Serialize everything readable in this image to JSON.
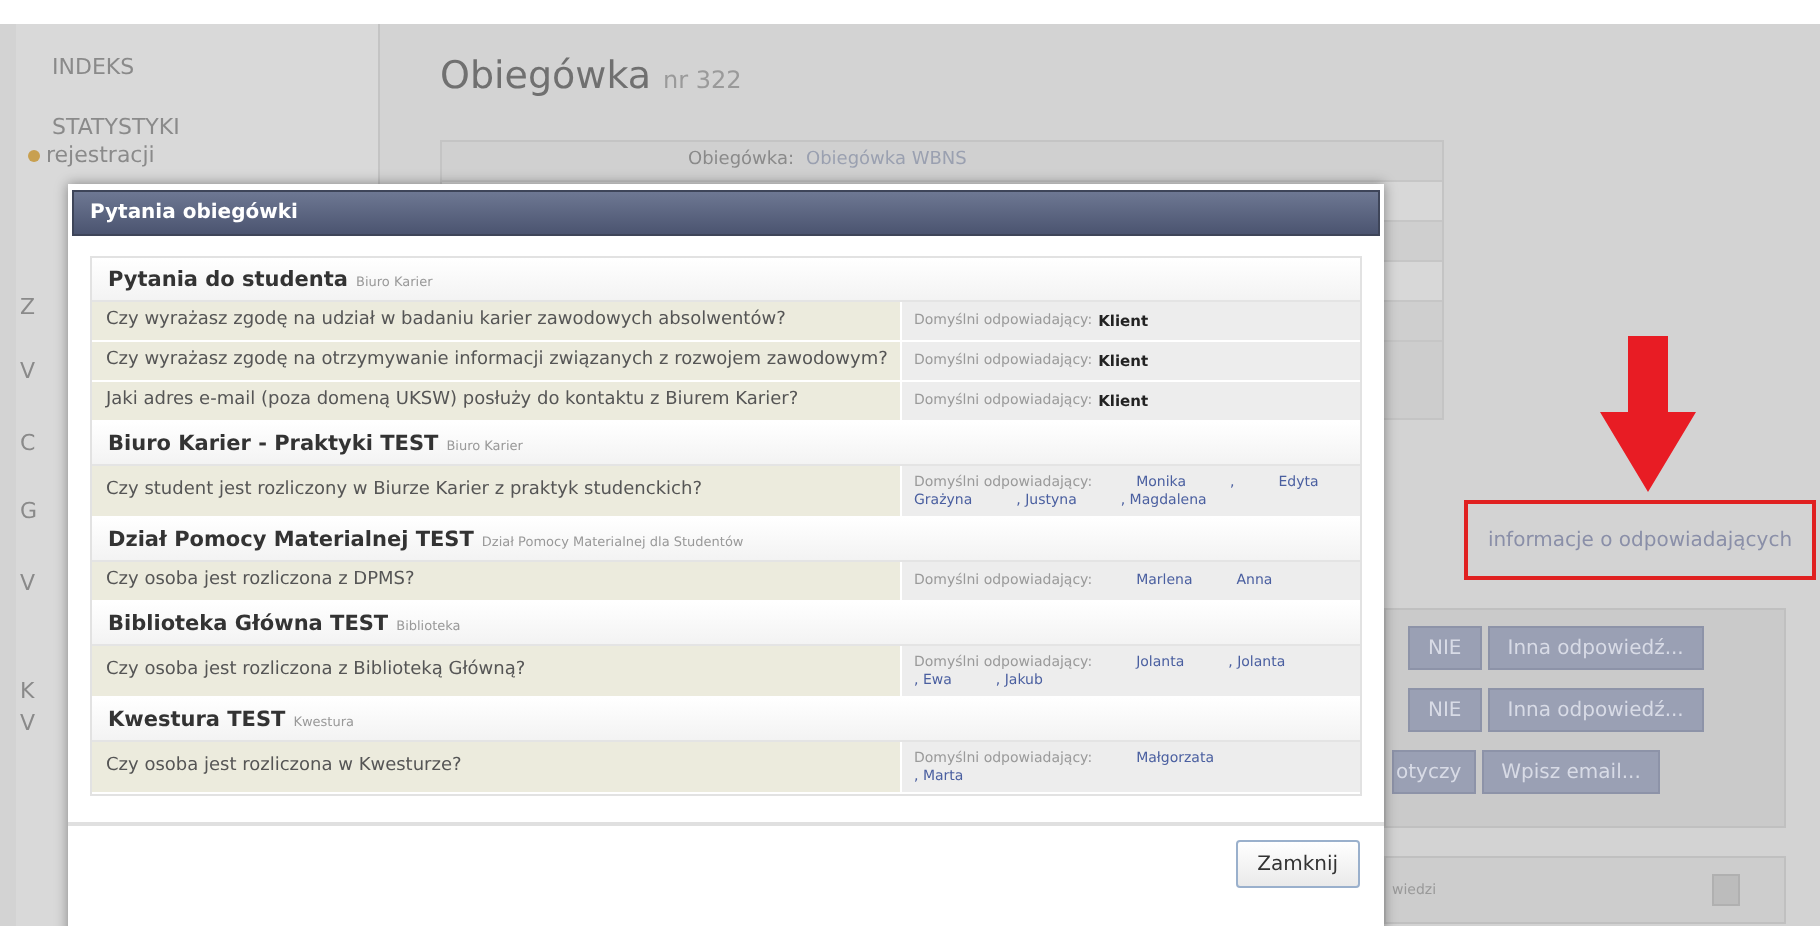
{
  "sidebar": {
    "headings": [
      "INDEKS",
      "STATYSTYKI"
    ],
    "subitem": "rejestracji",
    "cut_letters": [
      "Z",
      "V",
      "C",
      "G",
      "V",
      "K",
      "V"
    ]
  },
  "page": {
    "title": "Obiegówka",
    "number": "nr 322",
    "form_label": "Obiegówka:",
    "form_value": "Obiegówka WBNS",
    "responders_link": "informacje o odpowiadających",
    "answer_rows": [
      {
        "buttons": [
          "NIE",
          "Inna odpowiedź..."
        ]
      },
      {
        "buttons": [
          "NIE",
          "Inna odpowiedź..."
        ]
      },
      {
        "buttons": [
          "otyczy",
          "Wpisz email..."
        ]
      }
    ],
    "footer_text": "wiedzi"
  },
  "dialog": {
    "title": "Pytania obiegówki",
    "close_button": "Zamknij",
    "sections": [
      {
        "title": "Pytania do studenta",
        "unit": "Biuro Karier",
        "questions": [
          {
            "text": "Czy wyrażasz zgodę na udział w badaniu karier zawodowych absolwentów?",
            "prefix": "Domyślni odpowiadający:",
            "lines": [
              [
                {
                  "kind": "role",
                  "text": "Klient"
                }
              ]
            ]
          },
          {
            "text": "Czy wyrażasz zgodę na otrzymywanie informacji związanych z rozwojem zawodowym?",
            "prefix": "Domyślni odpowiadający:",
            "lines": [
              [
                {
                  "kind": "role",
                  "text": "Klient"
                }
              ]
            ]
          },
          {
            "text": "Jaki adres e-mail (poza domeną UKSW) posłuży do kontaktu z Biurem Karier?",
            "prefix": "Domyślni odpowiadający:",
            "lines": [
              [
                {
                  "kind": "role",
                  "text": "Klient"
                }
              ]
            ]
          }
        ]
      },
      {
        "title": "Biuro Karier - Praktyki TEST",
        "unit": "Biuro Karier",
        "questions": [
          {
            "text": "Czy student jest rozliczony w Biurze Karier z praktyk studenckich?",
            "prefix": "Domyślni odpowiadający:",
            "lines": [
              [
                {
                  "kind": "person",
                  "text": "Monika"
                },
                {
                  "kind": "person",
                  "text": ","
                },
                {
                  "kind": "person",
                  "text": "Edyta"
                }
              ],
              [
                {
                  "kind": "person",
                  "text": "Grażyna"
                },
                {
                  "kind": "person",
                  "text": ", Justyna"
                },
                {
                  "kind": "person",
                  "text": ", Magdalena"
                }
              ]
            ]
          }
        ]
      },
      {
        "title": "Dział Pomocy Materialnej TEST",
        "unit": "Dział Pomocy Materialnej dla Studentów",
        "questions": [
          {
            "text": "Czy osoba jest rozliczona z DPMS?",
            "prefix": "Domyślni odpowiadający:",
            "lines": [
              [
                {
                  "kind": "person",
                  "text": "Marlena"
                },
                {
                  "kind": "person",
                  "text": "Anna"
                }
              ]
            ]
          }
        ]
      },
      {
        "title": "Biblioteka Główna TEST",
        "unit": "Biblioteka",
        "questions": [
          {
            "text": "Czy osoba jest rozliczona z Biblioteką Główną?",
            "prefix": "Domyślni odpowiadający:",
            "lines": [
              [
                {
                  "kind": "person",
                  "text": "Jolanta"
                },
                {
                  "kind": "person",
                  "text": ", Jolanta"
                }
              ],
              [
                {
                  "kind": "person",
                  "text": ", Ewa"
                },
                {
                  "kind": "person",
                  "text": ", Jakub"
                }
              ]
            ]
          }
        ]
      },
      {
        "title": "Kwestura TEST",
        "unit": "Kwestura",
        "questions": [
          {
            "text": "Czy osoba jest rozliczona w Kwesturze?",
            "prefix": "Domyślni odpowiadający:",
            "lines": [
              [
                {
                  "kind": "person",
                  "text": "Małgorzata"
                }
              ],
              [
                {
                  "kind": "person",
                  "text": ", Marta"
                }
              ]
            ]
          }
        ]
      }
    ]
  }
}
